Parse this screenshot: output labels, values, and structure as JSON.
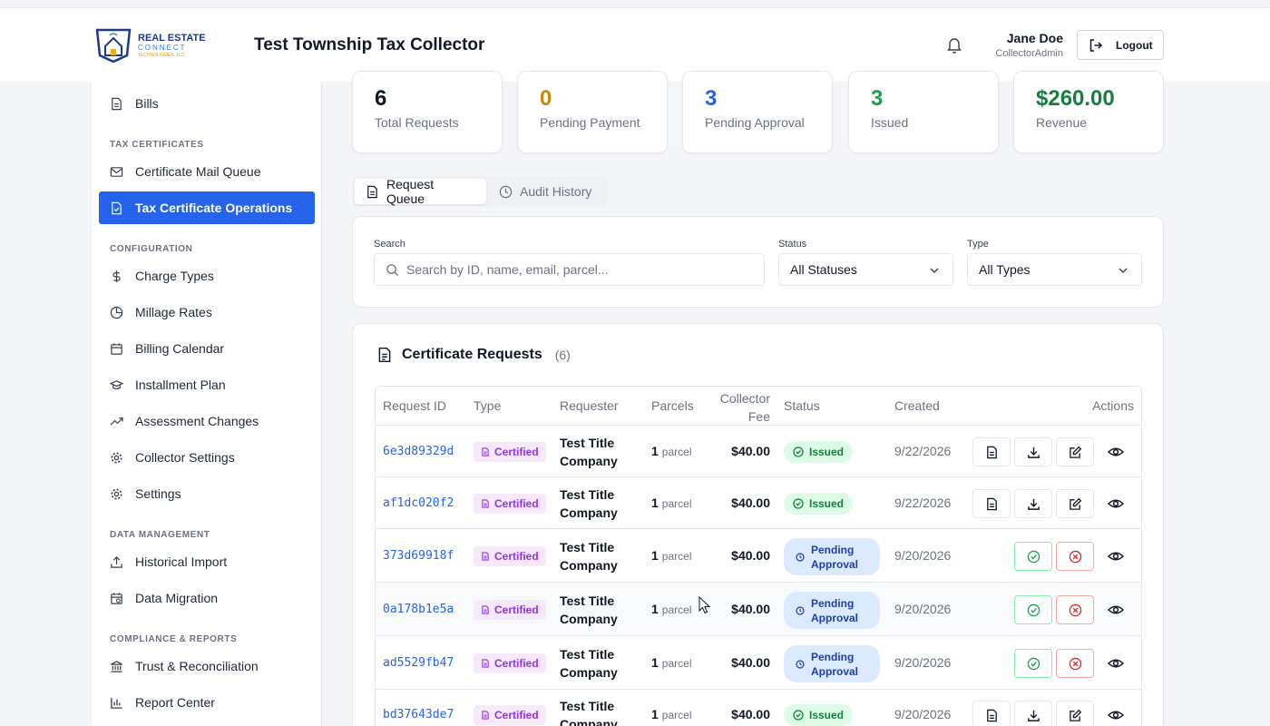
{
  "header": {
    "logo_line1": "REAL ESTATE",
    "logo_line2": "CONNECT",
    "logo_line3": "TECHNOLOGIES, LLC",
    "app_title": "Test Township Tax Collector",
    "user_name": "Jane Doe",
    "user_role": "CollectorAdmin",
    "logout_label": "Logout"
  },
  "sidebar": {
    "bills": "Bills",
    "head_tax": "TAX CERTIFICATES",
    "mail_queue": "Certificate Mail Queue",
    "tax_ops": "Tax Certificate Operations",
    "head_config": "CONFIGURATION",
    "charge_types": "Charge Types",
    "millage": "Millage Rates",
    "billing_calendar": "Billing Calendar",
    "installment": "Installment Plan",
    "assessment": "Assessment Changes",
    "collector_settings": "Collector Settings",
    "settings": "Settings",
    "head_data": "DATA MANAGEMENT",
    "historical": "Historical Import",
    "migration": "Data Migration",
    "head_comp": "COMPLIANCE & REPORTS",
    "trust": "Trust & Reconciliation",
    "report": "Report Center"
  },
  "stats": [
    {
      "value": "6",
      "label": "Total Requests",
      "color": "#111827"
    },
    {
      "value": "0",
      "label": "Pending Payment",
      "color": "#ca8a04"
    },
    {
      "value": "3",
      "label": "Pending Approval",
      "color": "#2563eb"
    },
    {
      "value": "3",
      "label": "Issued",
      "color": "#16a34a"
    },
    {
      "value": "$260.00",
      "label": "Revenue",
      "color": "#15803d"
    }
  ],
  "tabs": {
    "queue": "Request Queue",
    "audit": "Audit History"
  },
  "filters": {
    "search_label": "Search",
    "search_placeholder": "Search by ID, name, email, parcel...",
    "status_label": "Status",
    "status_value": "All Statuses",
    "type_label": "Type",
    "type_value": "All Types"
  },
  "requests": {
    "title": "Certificate Requests",
    "count": "(6)",
    "headers": {
      "id": "Request ID",
      "type": "Type",
      "requester": "Requester",
      "parcels": "Parcels",
      "fee1": "Collector",
      "fee2": "Fee",
      "status": "Status",
      "created": "Created",
      "actions": "Actions"
    },
    "parcel_unit": "parcel",
    "rows": [
      {
        "id": "6e3d89329d",
        "type": "Certified",
        "req1": "Test Title",
        "req2": "Company",
        "parcels": "1",
        "fee": "$40.00",
        "status": "Issued",
        "status_l1": "Issued",
        "status_l2": "",
        "created": "9/22/2026"
      },
      {
        "id": "af1dc020f2",
        "type": "Certified",
        "req1": "Test Title",
        "req2": "Company",
        "parcels": "1",
        "fee": "$40.00",
        "status": "Issued",
        "status_l1": "Issued",
        "status_l2": "",
        "created": "9/22/2026"
      },
      {
        "id": "373d69918f",
        "type": "Certified",
        "req1": "Test Title",
        "req2": "Company",
        "parcels": "1",
        "fee": "$40.00",
        "status": "Pending Approval",
        "status_l1": "Pending",
        "status_l2": "Approval",
        "created": "9/20/2026"
      },
      {
        "id": "0a178b1e5a",
        "type": "Certified",
        "req1": "Test Title",
        "req2": "Company",
        "parcels": "1",
        "fee": "$40.00",
        "status": "Pending Approval",
        "status_l1": "Pending",
        "status_l2": "Approval",
        "created": "9/20/2026"
      },
      {
        "id": "ad5529fb47",
        "type": "Certified",
        "req1": "Test Title",
        "req2": "Company",
        "parcels": "1",
        "fee": "$40.00",
        "status": "Pending Approval",
        "status_l1": "Pending",
        "status_l2": "Approval",
        "created": "9/20/2026"
      },
      {
        "id": "bd37643de7",
        "type": "Certified",
        "req1": "Test Title",
        "req2": "Company",
        "parcels": "1",
        "fee": "$40.00",
        "status": "Issued",
        "status_l1": "Issued",
        "status_l2": "",
        "created": "9/20/2026"
      }
    ]
  }
}
